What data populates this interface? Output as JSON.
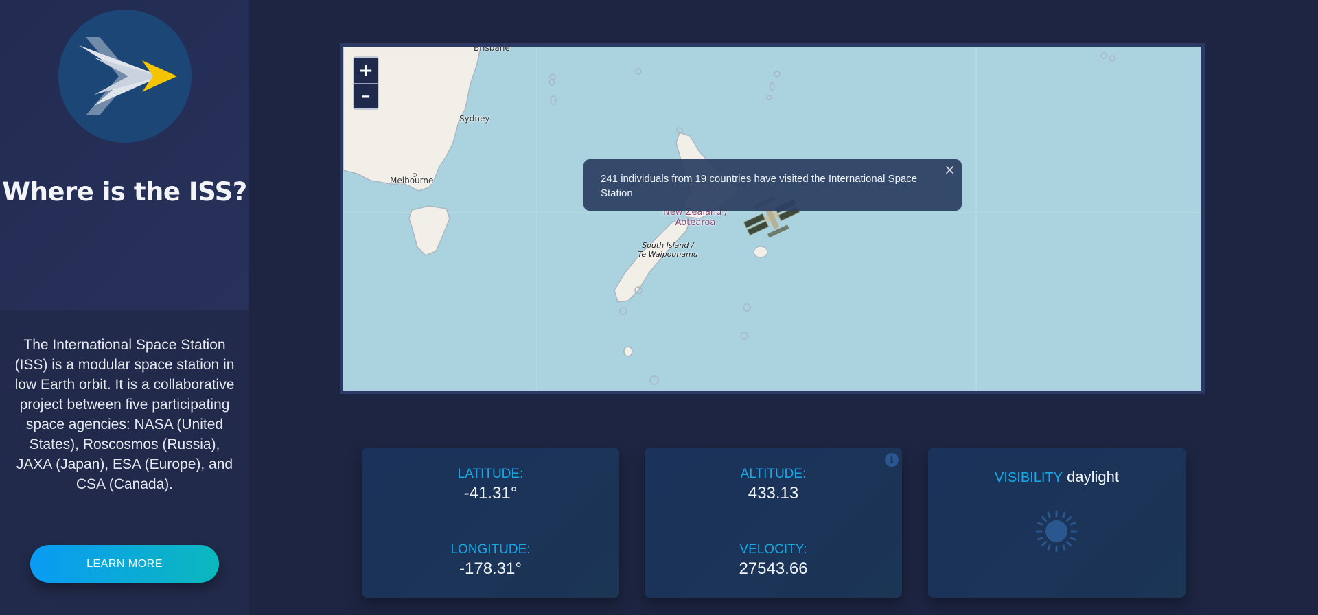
{
  "sidebar": {
    "title": "Where is the ISS?",
    "description": "The International Space Station (ISS) is a modular space station in low Earth orbit. It is a collaborative project between five participating space agencies: NASA (United States), Roscosmos (Russia), JAXA (Japan), ESA (Europe), and CSA (Canada).",
    "learn_more_label": "LEARN MORE",
    "logo_icon": "arrow-logo-icon"
  },
  "map": {
    "zoom_in_label": "+",
    "zoom_out_label": "–",
    "labels": {
      "brisbane": "Brisbane",
      "sydney": "Sydney",
      "melbourne": "Melbourne",
      "new_zealand_line1": "New Zealand /",
      "new_zealand_line2": "Aotearoa",
      "south_island_line1": "South Island /",
      "south_island_line2": "Te Waipounamu"
    },
    "popup": {
      "text": "241 individuals from 19 countries have visited the International Space Station",
      "close_label": "×"
    },
    "marker_icon": "iss-satellite-icon"
  },
  "stats": {
    "latitude_label": "LATITUDE:",
    "latitude_value": "-41.31°",
    "longitude_label": "LONGITUDE:",
    "longitude_value": "-178.31°",
    "altitude_label": "ALTITUDE:",
    "altitude_value": "433.13",
    "velocity_label": "VELOCITY:",
    "velocity_value": "27543.66",
    "visibility_label": "VISIBILITY",
    "visibility_value": "daylight",
    "info_icon": "info-icon",
    "visibility_icon": "sun-icon"
  },
  "colors": {
    "background": "#1d2542",
    "sidebar": "#212a4a",
    "accent": "#17a9e6",
    "button_gradient_start": "#0a9bf4",
    "button_gradient_end": "#0bb8bd",
    "logo_yellow": "#f5c400"
  }
}
